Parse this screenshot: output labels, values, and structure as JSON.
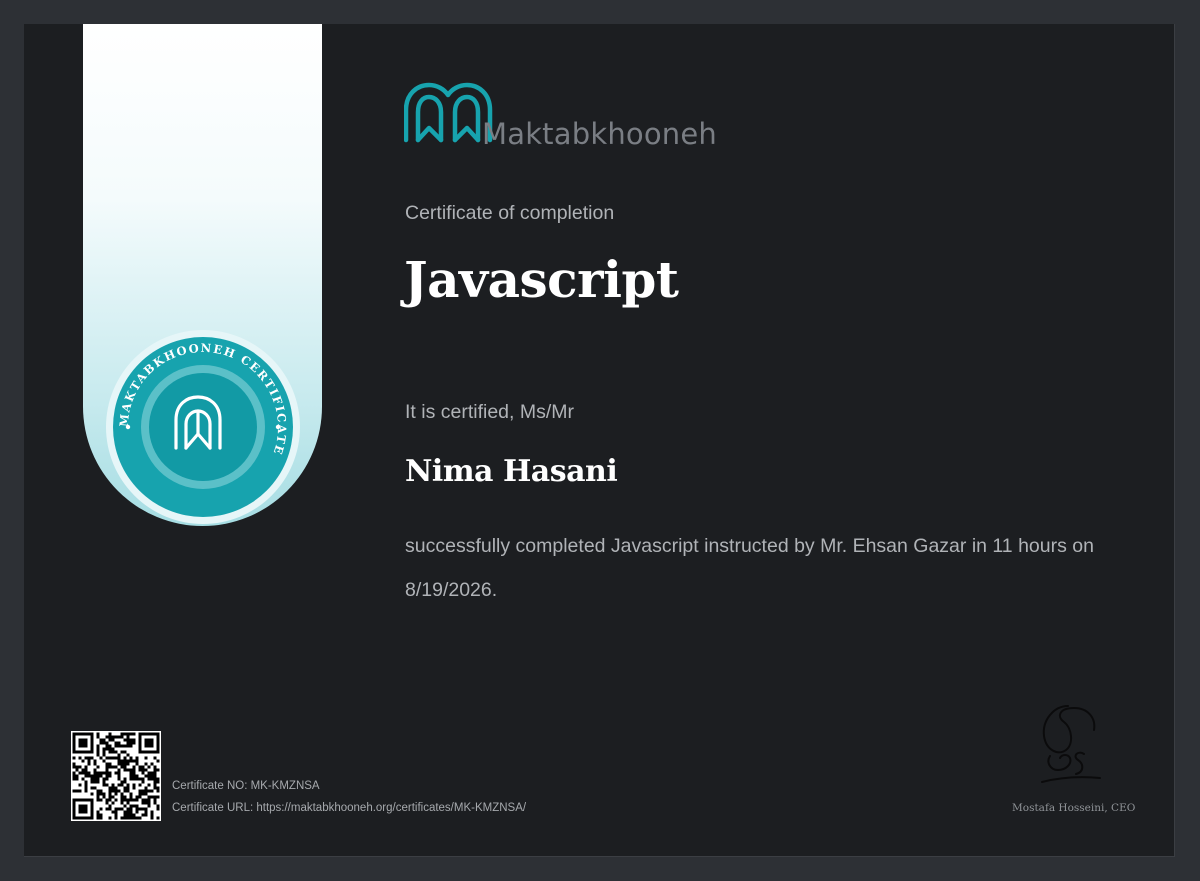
{
  "brand": {
    "name": "Maktabkhooneh",
    "seal_text": "MAKTABKHOONEH CERTIFICATE",
    "colors": {
      "teal": "#17a3ae",
      "teal_dark": "#0e8e99",
      "teal_light": "#6cc7cf"
    },
    "logo_icon": "maktabkhooneh-arch-logo-icon"
  },
  "certificate": {
    "eyebrow": "Certificate of completion",
    "course_title": "Javascript",
    "certified_label": "It is certified, Ms/Mr",
    "recipient": "Nima Hasani",
    "body": "successfully completed Javascript instructed by Mr. Ehsan Gazar in 11 hours on 8/19/2026.",
    "number_line": "Certificate NO: MK-KMZNSA",
    "url_line": "Certificate URL: https://maktabkhooneh.org/certificates/MK-KMZNSA/",
    "signatory": "Mostafa Hosseini, CEO"
  }
}
